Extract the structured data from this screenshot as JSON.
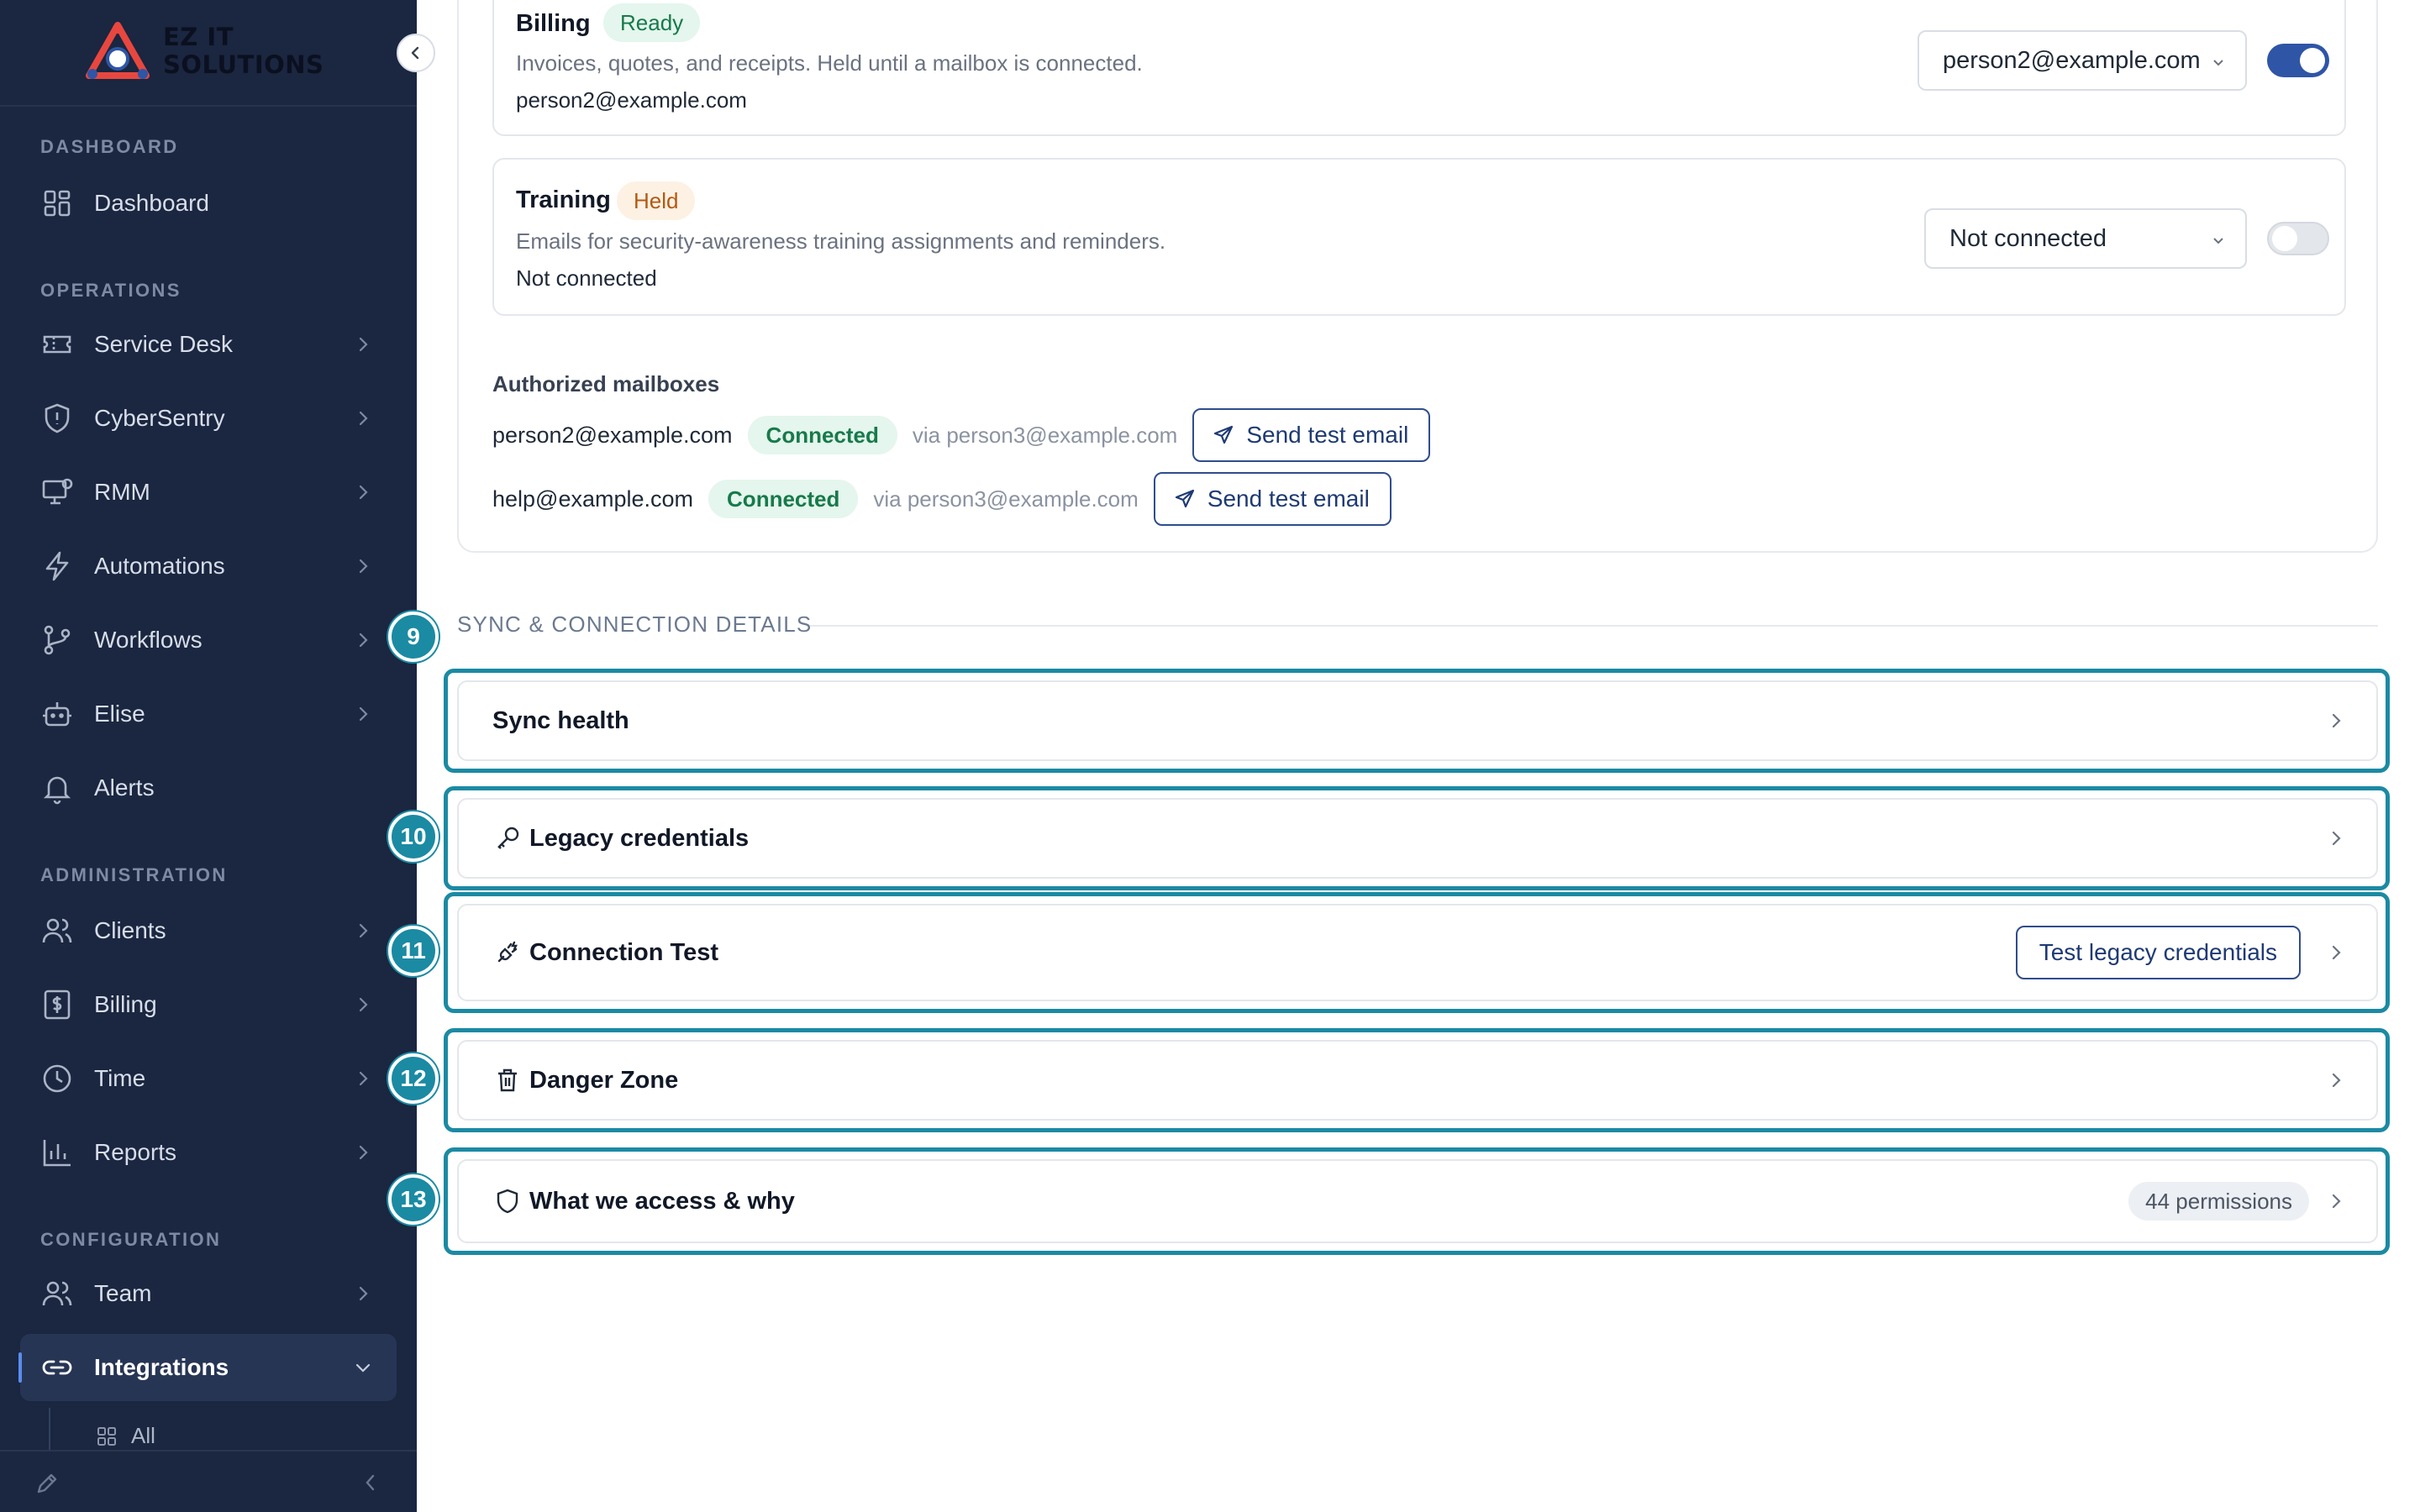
{
  "brand": {
    "name": "EZ IT SOLUTIONS"
  },
  "sidebar": {
    "sections": {
      "dashboard": "DASHBOARD",
      "operations": "OPERATIONS",
      "administration": "ADMINISTRATION",
      "configuration": "CONFIGURATION"
    },
    "items": [
      {
        "label": "Dashboard",
        "icon": "grid-icon"
      },
      {
        "label": "Service Desk",
        "icon": "ticket-icon"
      },
      {
        "label": "CyberSentry",
        "icon": "shield-icon"
      },
      {
        "label": "RMM",
        "icon": "monitor-icon"
      },
      {
        "label": "Automations",
        "icon": "bolt-icon"
      },
      {
        "label": "Workflows",
        "icon": "git-branch-icon"
      },
      {
        "label": "Elise",
        "icon": "robot-icon"
      },
      {
        "label": "Alerts",
        "icon": "bell-icon"
      },
      {
        "label": "Clients",
        "icon": "users-icon"
      },
      {
        "label": "Billing",
        "icon": "dollar-icon"
      },
      {
        "label": "Time",
        "icon": "clock-icon"
      },
      {
        "label": "Reports",
        "icon": "bar-chart-icon"
      },
      {
        "label": "Team",
        "icon": "team-icon"
      },
      {
        "label": "Integrations",
        "icon": "link-icon"
      }
    ],
    "sub_items": [
      {
        "label": "All",
        "icon": "grid-small-icon"
      }
    ]
  },
  "mailboxes": {
    "billing": {
      "title": "Billing",
      "status": "Ready",
      "description": "Invoices, quotes, and receipts. Held until a mailbox is connected.",
      "value": "person2@example.com",
      "select_value": "person2@example.com",
      "enabled": true
    },
    "training": {
      "title": "Training",
      "status": "Held",
      "description": "Emails for security-awareness training assignments and reminders.",
      "value": "Not connected",
      "select_value": "Not connected",
      "enabled": false
    },
    "authorized_heading": "Authorized mailboxes",
    "authorized": [
      {
        "email": "person2@example.com",
        "status": "Connected",
        "via": "via person3@example.com",
        "button": "Send test email"
      },
      {
        "email": "help@example.com",
        "status": "Connected",
        "via": "via person3@example.com",
        "button": "Send test email"
      }
    ]
  },
  "sync": {
    "heading": "SYNC & CONNECTION DETAILS",
    "steps": [
      "9",
      "10",
      "11",
      "12",
      "13"
    ],
    "sync_health": "Sync health",
    "legacy_credentials": "Legacy credentials",
    "connection_test": "Connection Test",
    "test_button": "Test legacy credentials",
    "danger_zone": "Danger Zone",
    "access": "What we access & why",
    "permissions": "44 permissions"
  },
  "colors": {
    "sidebar_bg": "#1b2640",
    "highlight": "#1b8aa3",
    "accent": "#2f55a6",
    "success": "#177a4a",
    "warning": "#b35a10"
  }
}
